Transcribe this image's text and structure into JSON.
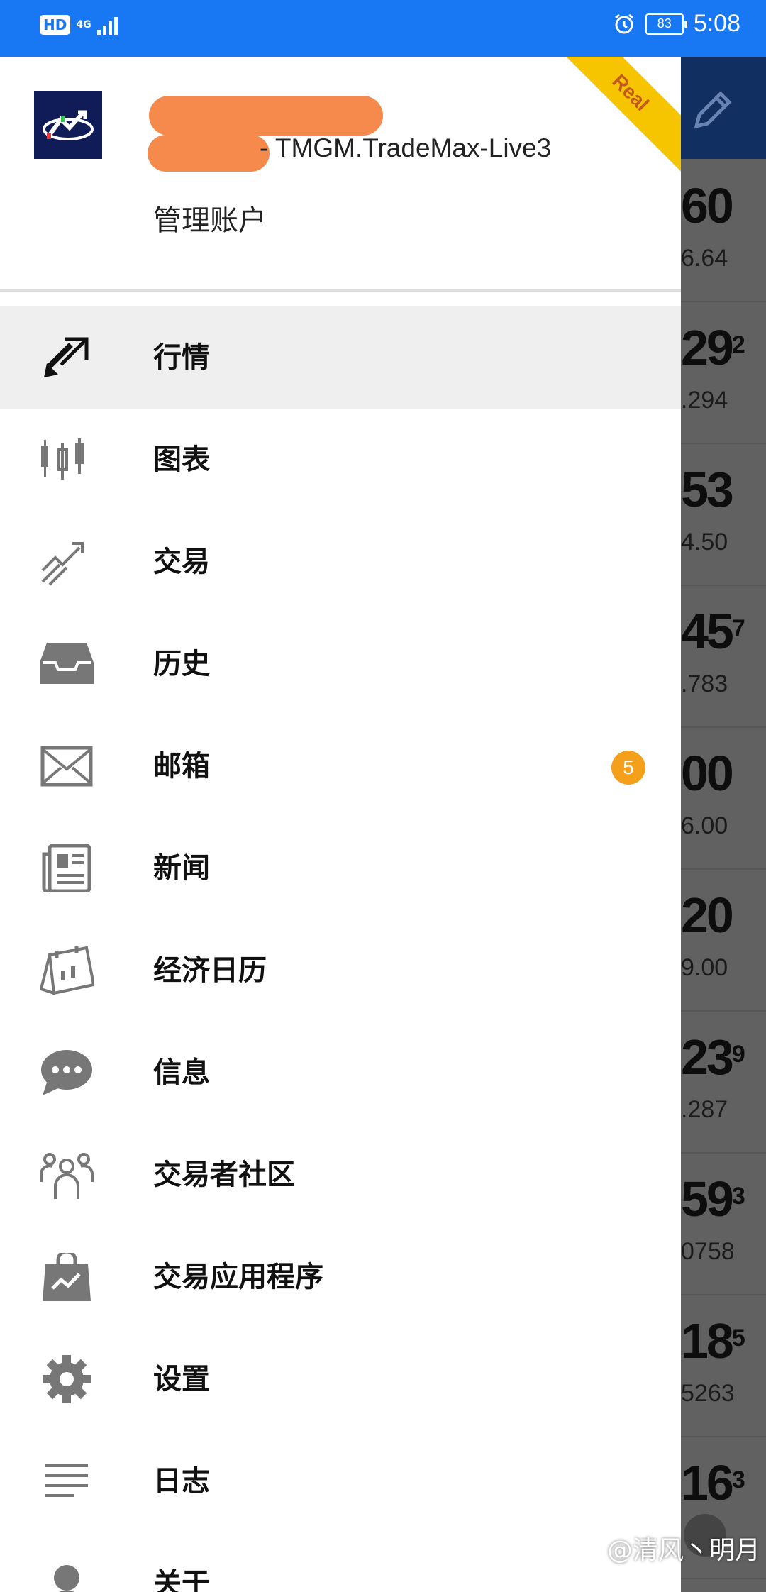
{
  "status_bar": {
    "hd": "HD",
    "network": "4G",
    "battery": "83",
    "time": "5:08"
  },
  "account": {
    "server": "- TMGM.TradeMax-Live3",
    "manage_label": "管理账户",
    "badge": "Real"
  },
  "menu": [
    {
      "label": "行情",
      "icon": "quotes-icon",
      "active": true
    },
    {
      "label": "图表",
      "icon": "chart-icon"
    },
    {
      "label": "交易",
      "icon": "trade-icon"
    },
    {
      "label": "历史",
      "icon": "history-icon"
    },
    {
      "label": "邮箱",
      "icon": "mail-icon",
      "badge": "5"
    },
    {
      "label": "新闻",
      "icon": "news-icon"
    },
    {
      "label": "经济日历",
      "icon": "calendar-icon"
    },
    {
      "label": "信息",
      "icon": "chat-icon"
    },
    {
      "label": "交易者社区",
      "icon": "community-icon"
    },
    {
      "label": "交易应用程序",
      "icon": "bag-icon"
    },
    {
      "label": "设置",
      "icon": "gear-icon"
    },
    {
      "label": "日志",
      "icon": "journal-icon"
    },
    {
      "label": "关于",
      "icon": "about-icon"
    }
  ],
  "background_quotes": [
    {
      "big": "60",
      "sup": "",
      "small": "6.64"
    },
    {
      "big": "29",
      "sup": "2",
      "small": ".294"
    },
    {
      "big": "53",
      "sup": "",
      "small": "4.50"
    },
    {
      "big": "45",
      "sup": "7",
      "small": ".783"
    },
    {
      "big": "00",
      "sup": "",
      "small": "6.00"
    },
    {
      "big": "20",
      "sup": "",
      "small": "9.00"
    },
    {
      "big": "23",
      "sup": "9",
      "small": ".287"
    },
    {
      "big": "59",
      "sup": "3",
      "small": "0758"
    },
    {
      "big": "18",
      "sup": "5",
      "small": "5263"
    },
    {
      "big": "16",
      "sup": "3",
      "small": ""
    }
  ],
  "watermark": "@清风丶明月",
  "colors": {
    "status_bar": "#1877f2",
    "badge": "#f5a01a",
    "ribbon": "#f7c400",
    "redaction": "#f58a4c"
  }
}
